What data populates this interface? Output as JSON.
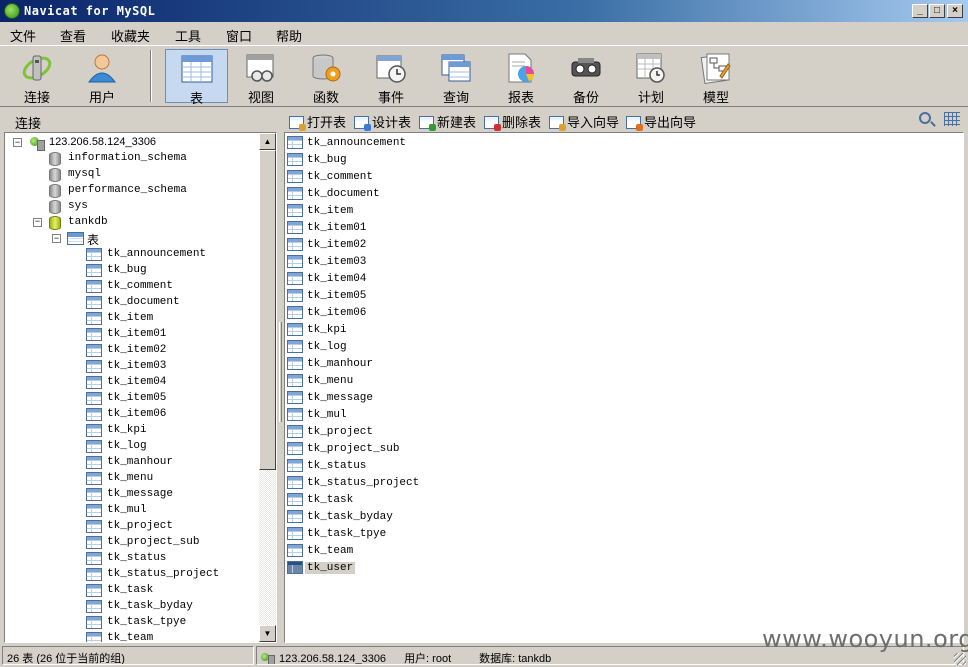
{
  "window": {
    "title": "Navicat for MySQL"
  },
  "menu": [
    "文件",
    "查看",
    "收藏夹",
    "工具",
    "窗口",
    "帮助"
  ],
  "toolbar": {
    "items": [
      {
        "label": "连接",
        "icon": "connection-icon"
      },
      {
        "label": "用户",
        "icon": "user-icon"
      },
      {
        "label": "表",
        "icon": "table-icon",
        "active": true
      },
      {
        "label": "视图",
        "icon": "view-icon"
      },
      {
        "label": "函数",
        "icon": "function-icon"
      },
      {
        "label": "事件",
        "icon": "event-icon"
      },
      {
        "label": "查询",
        "icon": "query-icon"
      },
      {
        "label": "报表",
        "icon": "report-icon"
      },
      {
        "label": "备份",
        "icon": "backup-icon"
      },
      {
        "label": "计划",
        "icon": "schedule-icon"
      },
      {
        "label": "模型",
        "icon": "model-icon"
      }
    ]
  },
  "left_header": "连接",
  "object_toolbar": [
    "打开表",
    "设计表",
    "新建表",
    "删除表",
    "导入向导",
    "导出向导"
  ],
  "tree": {
    "connection": "123.206.58.124_3306",
    "databases": [
      "information_schema",
      "mysql",
      "performance_schema",
      "sys"
    ],
    "open_database": "tankdb",
    "tables_folder": "表"
  },
  "tables": [
    "tk_announcement",
    "tk_bug",
    "tk_comment",
    "tk_document",
    "tk_item",
    "tk_item01",
    "tk_item02",
    "tk_item03",
    "tk_item04",
    "tk_item05",
    "tk_item06",
    "tk_kpi",
    "tk_log",
    "tk_manhour",
    "tk_menu",
    "tk_message",
    "tk_mul",
    "tk_project",
    "tk_project_sub",
    "tk_status",
    "tk_status_project",
    "tk_task",
    "tk_task_byday",
    "tk_task_tpye",
    "tk_team",
    "tk_user"
  ],
  "selected_table": "tk_user",
  "status": {
    "count": "26 表 (26 位于当前的组)",
    "connection": "123.206.58.124_3306",
    "user": "用户: root",
    "database": "数据库: tankdb"
  },
  "watermark": "www.wooyun.org"
}
